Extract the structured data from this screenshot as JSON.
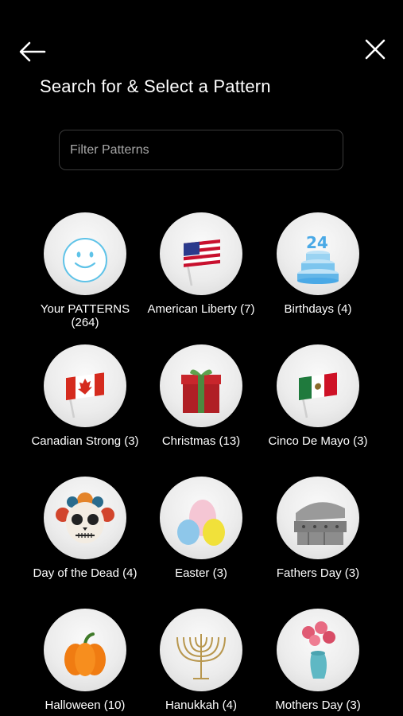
{
  "header": {
    "title": "Search for & Select a Pattern"
  },
  "search": {
    "placeholder": "Filter Patterns",
    "value": ""
  },
  "patterns": [
    {
      "label": "Your PATTERNS (264)",
      "icon": "smiley-face-icon"
    },
    {
      "label": "American Liberty (7)",
      "icon": "american-flag-icon"
    },
    {
      "label": "Birthdays (4)",
      "icon": "birthday-cake-icon"
    },
    {
      "label": "Canadian Strong (3)",
      "icon": "canadian-flag-icon"
    },
    {
      "label": "Christmas (13)",
      "icon": "gift-box-icon"
    },
    {
      "label": "Cinco De Mayo (3)",
      "icon": "mexican-flag-icon"
    },
    {
      "label": "Day of the Dead (4)",
      "icon": "sugar-skull-icon"
    },
    {
      "label": "Easter (3)",
      "icon": "easter-eggs-icon"
    },
    {
      "label": "Fathers Day (3)",
      "icon": "grill-icon"
    },
    {
      "label": "Halloween (10)",
      "icon": "pumpkin-icon"
    },
    {
      "label": "Hanukkah (4)",
      "icon": "menorah-icon"
    },
    {
      "label": "Mothers Day (3)",
      "icon": "flower-vase-icon"
    }
  ],
  "colors": {
    "background": "#000000",
    "text": "#ffffff",
    "search_border": "#3a3a3a",
    "placeholder": "#a8a8a8"
  }
}
